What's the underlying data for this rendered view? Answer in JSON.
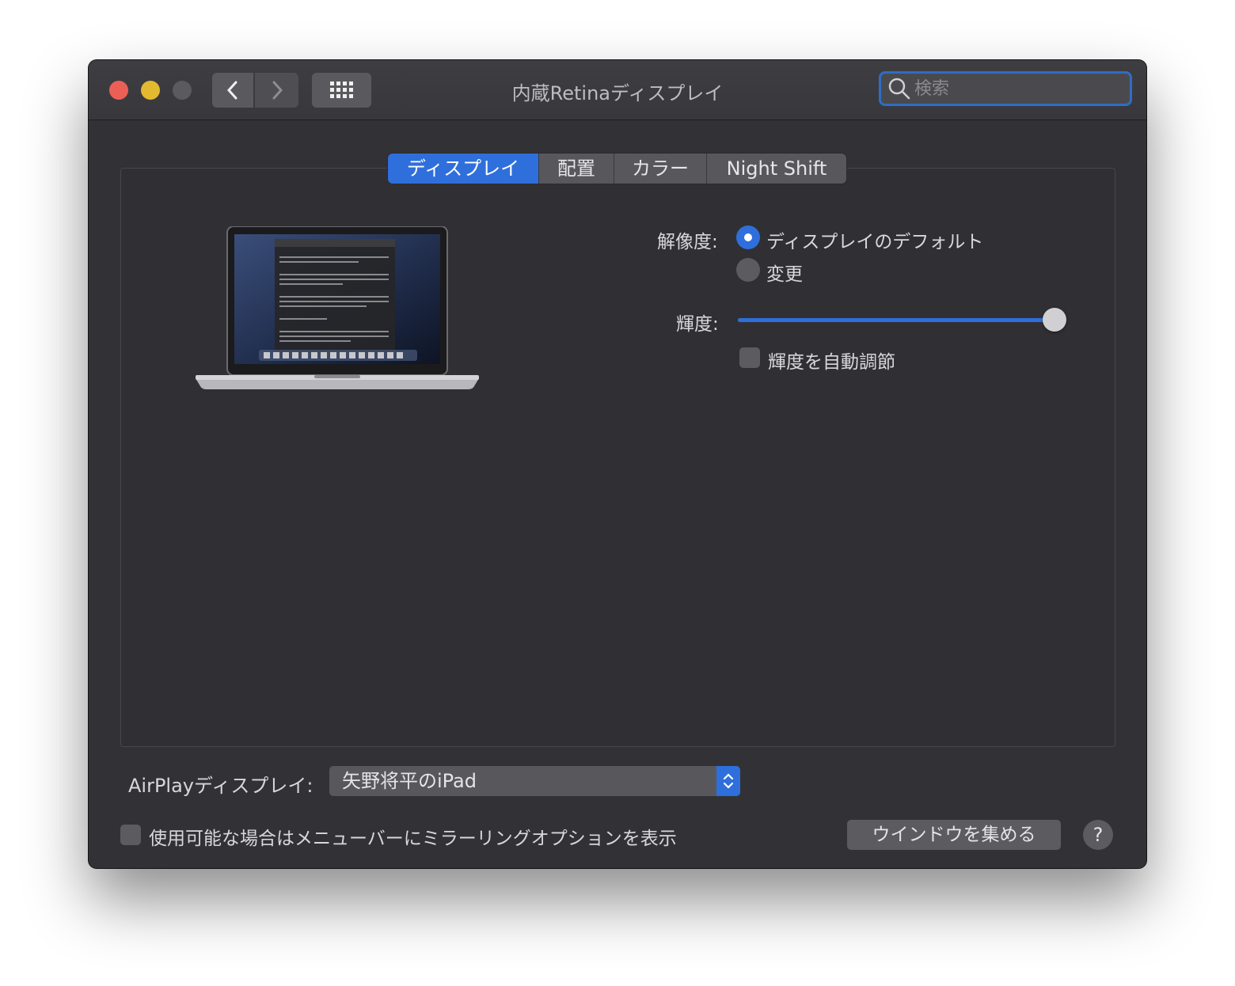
{
  "window": {
    "title": "内蔵Retinaディスプレイ",
    "search_placeholder": "検索"
  },
  "tabs": [
    {
      "label": "ディスプレイ",
      "active": true
    },
    {
      "label": "配置",
      "active": false
    },
    {
      "label": "カラー",
      "active": false
    },
    {
      "label": "Night Shift",
      "active": false
    }
  ],
  "resolution": {
    "label": "解像度:",
    "options": [
      {
        "label": "ディスプレイのデフォルト",
        "selected": true
      },
      {
        "label": "変更",
        "selected": false
      }
    ]
  },
  "brightness": {
    "label": "輝度:",
    "value": 1.0,
    "auto_label": "輝度を自動調節",
    "auto_checked": false
  },
  "airplay": {
    "label": "AirPlayディスプレイ:",
    "selected": "矢野将平のiPad"
  },
  "mirroring": {
    "label": "使用可能な場合はメニューバーにミラーリングオプションを表示",
    "checked": false
  },
  "gather_button": "ウインドウを集める",
  "help_button": "?",
  "colors": {
    "accent": "#2f6fdc",
    "window_bg": "#323236",
    "close": "#ec5f57",
    "minimize": "#e3b92f"
  },
  "icons": [
    "chevron-left-icon",
    "chevron-right-icon",
    "grid-icon",
    "search-icon",
    "laptop-icon",
    "updown-chevron-icon"
  ]
}
